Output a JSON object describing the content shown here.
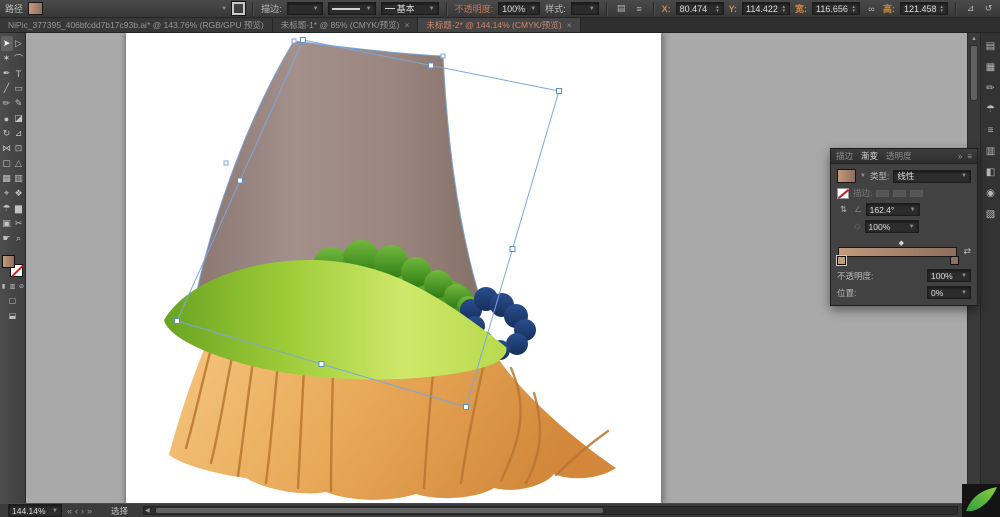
{
  "colors": {
    "ui_background": "#3c3c3c",
    "panel_background": "#424242",
    "canvas_background": "#a9a9a9",
    "selection_blue": "#7ba7dc",
    "active_tab_text": "#c8876a",
    "amber_label": "#cf8a3b",
    "trunk_brown": "#9a8580",
    "grass_light_green": "#d9ee86",
    "grass_dark_green": "#6fa928",
    "bush_green": "#3f8f22",
    "bush_blue": "#1d3c72",
    "stump_orange": "#e8a958",
    "root_line": "#b97631",
    "gradient_stop_left": "#c49a7a",
    "gradient_stop_right": "#8f6e5d"
  },
  "control_bar": {
    "object_label": "路径",
    "stroke_label": "描边:",
    "stroke_width_value": "",
    "brush_value": "基本",
    "opacity_label": "不透明度:",
    "opacity_value": "100%",
    "style_label": "样式:",
    "transform": {
      "x_label": "X:",
      "x_value": "80.474",
      "y_label": "Y:",
      "y_value": "114.422",
      "w_label": "宽:",
      "w_value": "116.656",
      "h_label": "高:",
      "h_value": "121.458"
    }
  },
  "tab_bar": {
    "tab1": {
      "title": "NiPic_377395_406bfcdd7b17c93b.ai* @ 143.76% (RGB/GPU 预览)"
    },
    "tab2": {
      "title": "未标题-1* @ 85% (CMYK/预览)"
    },
    "tab3": {
      "title": "未标题-2* @ 144.14% (CMYK/预览)"
    },
    "close_glyph": "×"
  },
  "toolbar": {
    "tools": [
      {
        "name": "selection-tool",
        "glyph": "➤",
        "active": true
      },
      {
        "name": "direct-selection-tool",
        "glyph": "▷"
      },
      {
        "name": "magic-wand-tool",
        "glyph": "✶"
      },
      {
        "name": "lasso-tool",
        "glyph": "⌒"
      },
      {
        "name": "pen-tool",
        "glyph": "✒"
      },
      {
        "name": "type-tool",
        "glyph": "T"
      },
      {
        "name": "line-segment-tool",
        "glyph": "╱"
      },
      {
        "name": "rectangle-tool",
        "glyph": "▭"
      },
      {
        "name": "paintbrush-tool",
        "glyph": "✏"
      },
      {
        "name": "pencil-tool",
        "glyph": "✎"
      },
      {
        "name": "blob-brush-tool",
        "glyph": "●"
      },
      {
        "name": "eraser-tool",
        "glyph": "◪"
      },
      {
        "name": "rotate-tool",
        "glyph": "↻"
      },
      {
        "name": "scale-tool",
        "glyph": "⊿"
      },
      {
        "name": "width-tool",
        "glyph": "⋈"
      },
      {
        "name": "free-transform-tool",
        "glyph": "⊡"
      },
      {
        "name": "shape-builder-tool",
        "glyph": "▢"
      },
      {
        "name": "perspective-grid-tool",
        "glyph": "△"
      },
      {
        "name": "mesh-tool",
        "glyph": "▦"
      },
      {
        "name": "gradient-tool",
        "glyph": "▥"
      },
      {
        "name": "eyedropper-tool",
        "glyph": "⌖"
      },
      {
        "name": "blend-tool",
        "glyph": "❖"
      },
      {
        "name": "symbol-sprayer-tool",
        "glyph": "☂"
      },
      {
        "name": "column-graph-tool",
        "glyph": "▆"
      },
      {
        "name": "artboard-tool",
        "glyph": "▣"
      },
      {
        "name": "slice-tool",
        "glyph": "✂"
      },
      {
        "name": "hand-tool",
        "glyph": "☛"
      },
      {
        "name": "zoom-tool",
        "glyph": "⌕"
      }
    ]
  },
  "dock": {
    "icons": [
      {
        "name": "color-panel-icon",
        "glyph": "▤"
      },
      {
        "name": "swatches-panel-icon",
        "glyph": "▦"
      },
      {
        "name": "brushes-panel-icon",
        "glyph": "✏"
      },
      {
        "name": "symbols-panel-icon",
        "glyph": "☂"
      },
      {
        "name": "stroke-panel-icon",
        "glyph": "≡"
      },
      {
        "name": "gradient-panel-icon",
        "glyph": "▥"
      },
      {
        "name": "transparency-panel-icon",
        "glyph": "◧"
      },
      {
        "name": "appearance-panel-icon",
        "glyph": "◉"
      },
      {
        "name": "layers-panel-icon",
        "glyph": "▧"
      }
    ]
  },
  "gradient_panel": {
    "tab_stroke": "描边",
    "tab_gradient": "渐变",
    "tab_transparency": "透明度",
    "type_label": "类型:",
    "type_value": "线性",
    "stroke_label": "描边:",
    "angle_value": "162.4°",
    "aspect_value": "100%",
    "opacity_label": "不透明度:",
    "opacity_value": "100%",
    "location_label": "位置:",
    "location_value": "0%",
    "gradient_stops": [
      {
        "color": "#c49a7a",
        "position": "0%"
      },
      {
        "color": "#8f6e5d",
        "position": "100%"
      }
    ]
  },
  "status_bar": {
    "zoom_value": "144.14%",
    "tool_hint": "选择"
  }
}
